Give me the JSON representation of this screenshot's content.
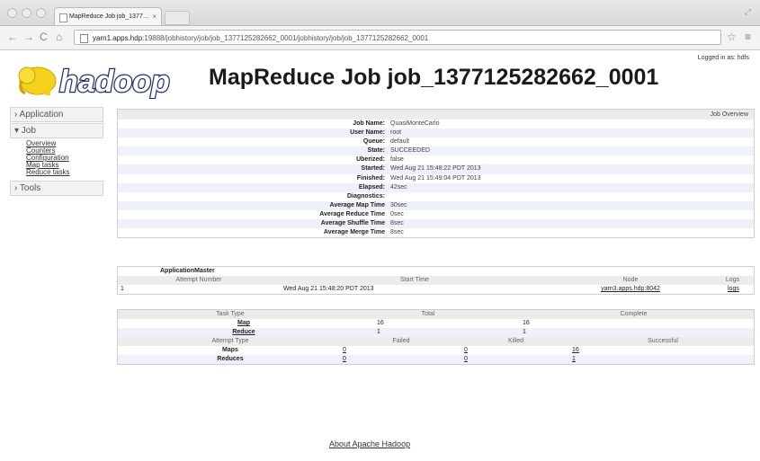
{
  "browser": {
    "tab_title": "MapReduce Job job_1377…",
    "url_host": "yarn1.apps.hdp",
    "url_rest": ":19888/jobhistory/job/job_1377125282662_0001/jobhistory/job/job_1377125282662_0001"
  },
  "header": {
    "logo_text": "hadoop",
    "title": "MapReduce Job job_1377125282662_0001",
    "logged_in": "Logged in as: hdfs"
  },
  "nav": {
    "application": "› Application",
    "job": "▾ Job",
    "job_links": [
      "Overview",
      "Counters",
      "Configuration",
      "Map tasks",
      "Reduce tasks"
    ],
    "tools": "› Tools"
  },
  "overview": {
    "header": "Job Overview",
    "rows": [
      {
        "k": "Job Name:",
        "v": "QuasiMonteCarlo"
      },
      {
        "k": "User Name:",
        "v": "root"
      },
      {
        "k": "Queue:",
        "v": "default"
      },
      {
        "k": "State:",
        "v": "SUCCEEDED"
      },
      {
        "k": "Uberized:",
        "v": "false"
      },
      {
        "k": "Started:",
        "v": "Wed Aug 21 15:48:22 PDT 2013"
      },
      {
        "k": "Finished:",
        "v": "Wed Aug 21 15:49:04 PDT 2013"
      },
      {
        "k": "Elapsed:",
        "v": "42sec"
      },
      {
        "k": "Diagnostics:",
        "v": ""
      },
      {
        "k": "Average Map Time",
        "v": "30sec"
      },
      {
        "k": "Average Reduce Time",
        "v": "0sec"
      },
      {
        "k": "Average Shuffle Time",
        "v": "8sec"
      },
      {
        "k": "Average Merge Time",
        "v": "8sec"
      }
    ]
  },
  "am": {
    "title": "ApplicationMaster",
    "cols": [
      "Attempt Number",
      "Start Time",
      "Node",
      "Logs"
    ],
    "row": {
      "attempt": "1",
      "start": "Wed Aug 21 15:48:20 PDT 2013",
      "node": "yarn3.apps.hdp:8042",
      "logs": "logs"
    }
  },
  "tasks": {
    "cols": [
      "Task Type",
      "Total",
      "Complete"
    ],
    "map": {
      "label": "Map",
      "total": "16",
      "complete": "16"
    },
    "reduce": {
      "label": "Reduce",
      "total": "1",
      "complete": "1"
    },
    "attempt_cols": [
      "Attempt Type",
      "Failed",
      "Killed",
      "Successful"
    ],
    "maps": {
      "label": "Maps",
      "failed": "0",
      "killed": "0",
      "successful": "16"
    },
    "reduces": {
      "label": "Reduces",
      "failed": "0",
      "killed": "0",
      "successful": "1"
    }
  },
  "footer": {
    "link": "About Apache Hadoop"
  }
}
